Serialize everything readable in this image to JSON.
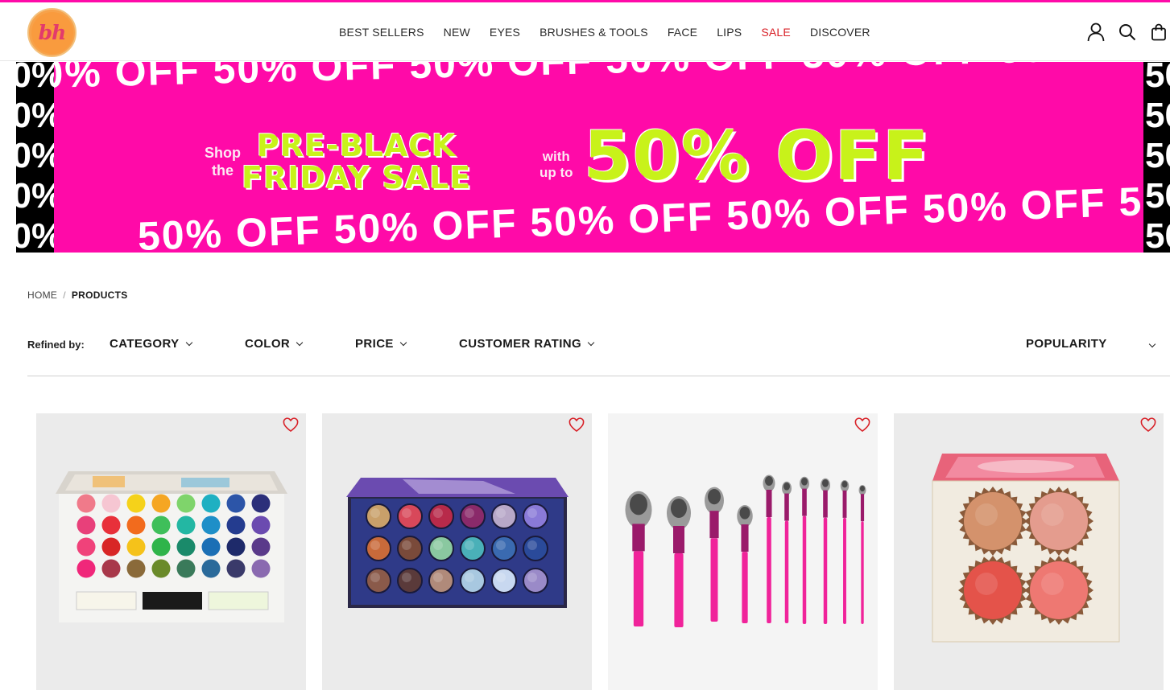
{
  "brand": {
    "logo_text": "bh"
  },
  "nav": {
    "items": [
      {
        "label": "BEST SELLERS",
        "sale": false
      },
      {
        "label": "NEW",
        "sale": false
      },
      {
        "label": "EYES",
        "sale": false
      },
      {
        "label": "BRUSHES & TOOLS",
        "sale": false
      },
      {
        "label": "FACE",
        "sale": false
      },
      {
        "label": "LIPS",
        "sale": false
      },
      {
        "label": "SALE",
        "sale": true
      },
      {
        "label": "DISCOVER",
        "sale": false
      }
    ]
  },
  "header_icons": [
    "account-icon",
    "search-icon",
    "bag-icon"
  ],
  "banner": {
    "shop_line1": "Shop",
    "shop_line2": "the",
    "title_line1": "PRE-BLACK",
    "title_line2": "FRIDAY SALE",
    "with_line1": "with",
    "with_line2": "up to",
    "offer": "50% OFF",
    "strip_text": "50% OFF 50% OFF 50% OFF 50% OFF 50% OFF 50%",
    "colors": {
      "pink": "#ff0aa8",
      "lime": "#c8f21a",
      "black": "#000000"
    }
  },
  "breadcrumb": {
    "home": "HOME",
    "separator": "/",
    "current": "PRODUCTS"
  },
  "filters": {
    "refined_label": "Refined by:",
    "items": [
      "CATEGORY",
      "COLOR",
      "PRICE",
      "CUSTOMER RATING"
    ],
    "sort_value": "POPULARITY"
  },
  "products": [
    {
      "kind": "rainbow-eyeshadow-palette"
    },
    {
      "kind": "galaxy-baked-eyeshadow-palette"
    },
    {
      "kind": "pink-brush-set"
    },
    {
      "kind": "blush-quad-palette"
    }
  ],
  "accent": {
    "heart": "#d81f26",
    "sale": "#d81f26"
  }
}
